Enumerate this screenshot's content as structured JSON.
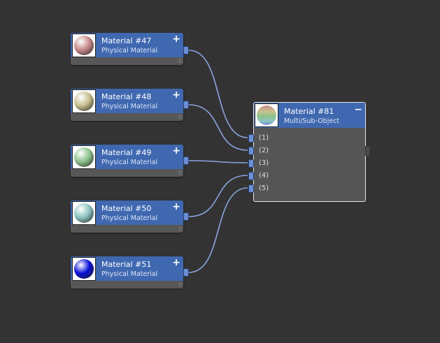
{
  "editor": {
    "background": "#333333",
    "wire_color": "#8aa4e0",
    "header_color": "#3f68b0"
  },
  "source_nodes": [
    {
      "title": "Material #47",
      "subtitle": "Physical Material",
      "expand": "+",
      "sphere_color": "#c88a8a"
    },
    {
      "title": "Material #48",
      "subtitle": "Physical Material",
      "expand": "+",
      "sphere_color": "#c8c08e"
    },
    {
      "title": "Material #49",
      "subtitle": "Physical Material",
      "expand": "+",
      "sphere_color": "#8ec48e"
    },
    {
      "title": "Material #50",
      "subtitle": "Physical Material",
      "expand": "+",
      "sphere_color": "#8ec4c2"
    },
    {
      "title": "Material #51",
      "subtitle": "Physical Material",
      "expand": "+",
      "sphere_color": "#0a10d8"
    }
  ],
  "target_node": {
    "title": "Material #81",
    "subtitle": "Multi/Sub-Object",
    "collapse": "−",
    "slots": [
      "(1)",
      "(2)",
      "(3)",
      "(4)",
      "(5)"
    ]
  }
}
